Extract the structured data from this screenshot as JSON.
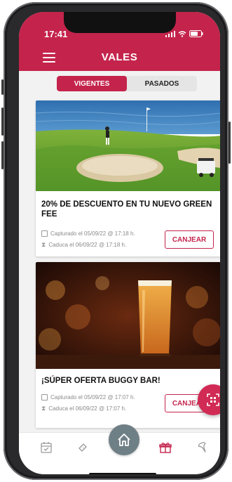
{
  "status": {
    "time": "17:41"
  },
  "header": {
    "title": "VALES"
  },
  "tabs": [
    {
      "label": "VIGENTES",
      "active": true
    },
    {
      "label": "PASADOS",
      "active": false
    }
  ],
  "vouchers": [
    {
      "title": "20% DE DESCUENTO EN TU NUEVO GREEN FEE",
      "captured": "Capturado el 05/09/22 @ 17:18 h.",
      "expires": "Caduca el 06/09/22 @ 17:18 h.",
      "action": "CANJEAR",
      "image": "golf-course"
    },
    {
      "title": "¡SÚPER OFERTA BUGGY BAR!",
      "captured": "Capturado el 05/09/22 @ 17:07 h.",
      "expires": "Caduca el 06/09/22 @ 17:07 h.",
      "action": "CANJEAR",
      "image": "beer-glass"
    }
  ],
  "icons": {
    "menu": "hamburger-icon",
    "fab": "qr-scan-icon",
    "nav": [
      "calendar-icon",
      "ticket-icon",
      "home-icon",
      "gift-icon",
      "tee-icon"
    ]
  },
  "colors": {
    "brand": "#c4244c",
    "nav_active": "#c4244c",
    "nav_inactive": "#9a9a9a"
  }
}
